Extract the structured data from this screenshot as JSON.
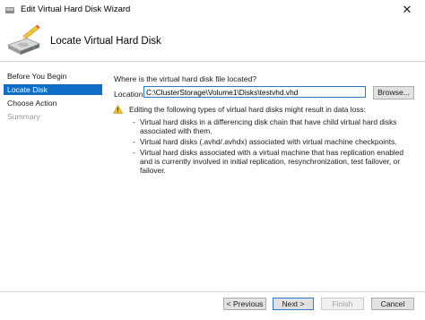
{
  "window": {
    "title": "Edit Virtual Hard Disk Wizard",
    "close_glyph": "✕"
  },
  "header": {
    "title": "Locate Virtual Hard Disk",
    "icon": "hard-disk-pencil-icon"
  },
  "sidebar": {
    "items": [
      {
        "label": "Before You Begin",
        "state": "normal"
      },
      {
        "label": "Locate Disk",
        "state": "active"
      },
      {
        "label": "Choose Action",
        "state": "normal"
      },
      {
        "label": "Summary",
        "state": "disabled"
      }
    ]
  },
  "main": {
    "question": "Where is the virtual hard disk file located?",
    "location_label": "Location:",
    "location_value": "C:\\ClusterStorage\\Volume1\\Disks\\testvhd.vhd",
    "browse_label": "Browse...",
    "warning_text": "Editing the following types of virtual hard disks might result in data loss:",
    "bullets": [
      {
        "dash": "-",
        "text": "Virtual hard disks in a differencing disk chain that have child virtual hard disks associated with them."
      },
      {
        "dash": "-",
        "text": "Virtual hard disks (.avhd/.avhdx) associated with virtual machine checkpoints."
      },
      {
        "dash": "-",
        "text": "Virtual hard disks associated with a virtual machine that has replication enabled and is currently involved in initial replication, resynchronization, test failover, or failover."
      }
    ]
  },
  "footer": {
    "previous_label": "< Previous",
    "next_label": "Next >",
    "finish_label": "Finish",
    "cancel_label": "Cancel"
  },
  "colors": {
    "accent": "#0f6fc6",
    "warning": "#f2c12e"
  }
}
